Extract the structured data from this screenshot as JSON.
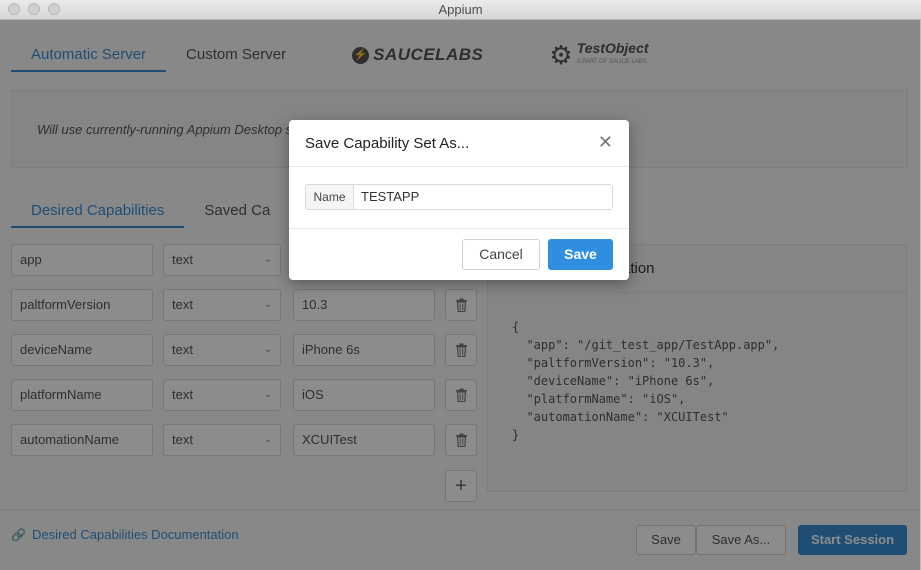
{
  "window": {
    "title": "Appium"
  },
  "server_tabs": [
    {
      "label": "Automatic Server",
      "active": true
    },
    {
      "label": "Custom Server",
      "active": false
    }
  ],
  "providers": {
    "saucelabs": "SAUCELABS",
    "testobject": "TestObject",
    "testobject_sub": "A PART OF SAUCE LABS"
  },
  "info_text": "Will use currently-running Appium Desktop s",
  "cap_tabs": [
    {
      "label": "Desired Capabilities",
      "active": true
    },
    {
      "label": "Saved Ca",
      "active": false
    }
  ],
  "capabilities": [
    {
      "name": "app",
      "type": "text",
      "value": ""
    },
    {
      "name": "paltformVersion",
      "type": "text",
      "value": "10.3"
    },
    {
      "name": "deviceName",
      "type": "text",
      "value": "iPhone 6s"
    },
    {
      "name": "platformName",
      "type": "text",
      "value": "iOS"
    },
    {
      "name": "automationName",
      "type": "text",
      "value": "XCUITest"
    }
  ],
  "json_panel": {
    "title": "ation",
    "lines": [
      "{",
      "  \"app\": \"/git_test_app/TestApp.app\",",
      "  \"paltformVersion\": \"10.3\",",
      "  \"deviceName\": \"iPhone 6s\",",
      "  \"platformName\": \"iOS\",",
      "  \"automationName\": \"XCUITest\"",
      "}"
    ]
  },
  "footer": {
    "doc_link": "Desired Capabilities Documentation",
    "save": "Save",
    "save_as": "Save As...",
    "start_session": "Start Session"
  },
  "modal": {
    "title": "Save Capability Set As...",
    "name_label": "Name",
    "name_value": "TESTAPP",
    "cancel": "Cancel",
    "save": "Save"
  },
  "icons": {
    "close": "close-icon",
    "trash": "trash-icon",
    "plus": "plus-icon",
    "link": "link-icon",
    "chevron": "chevron-down-icon"
  },
  "colors": {
    "accent": "#3a8fd6",
    "modal_primary": "#2f8ee0"
  }
}
